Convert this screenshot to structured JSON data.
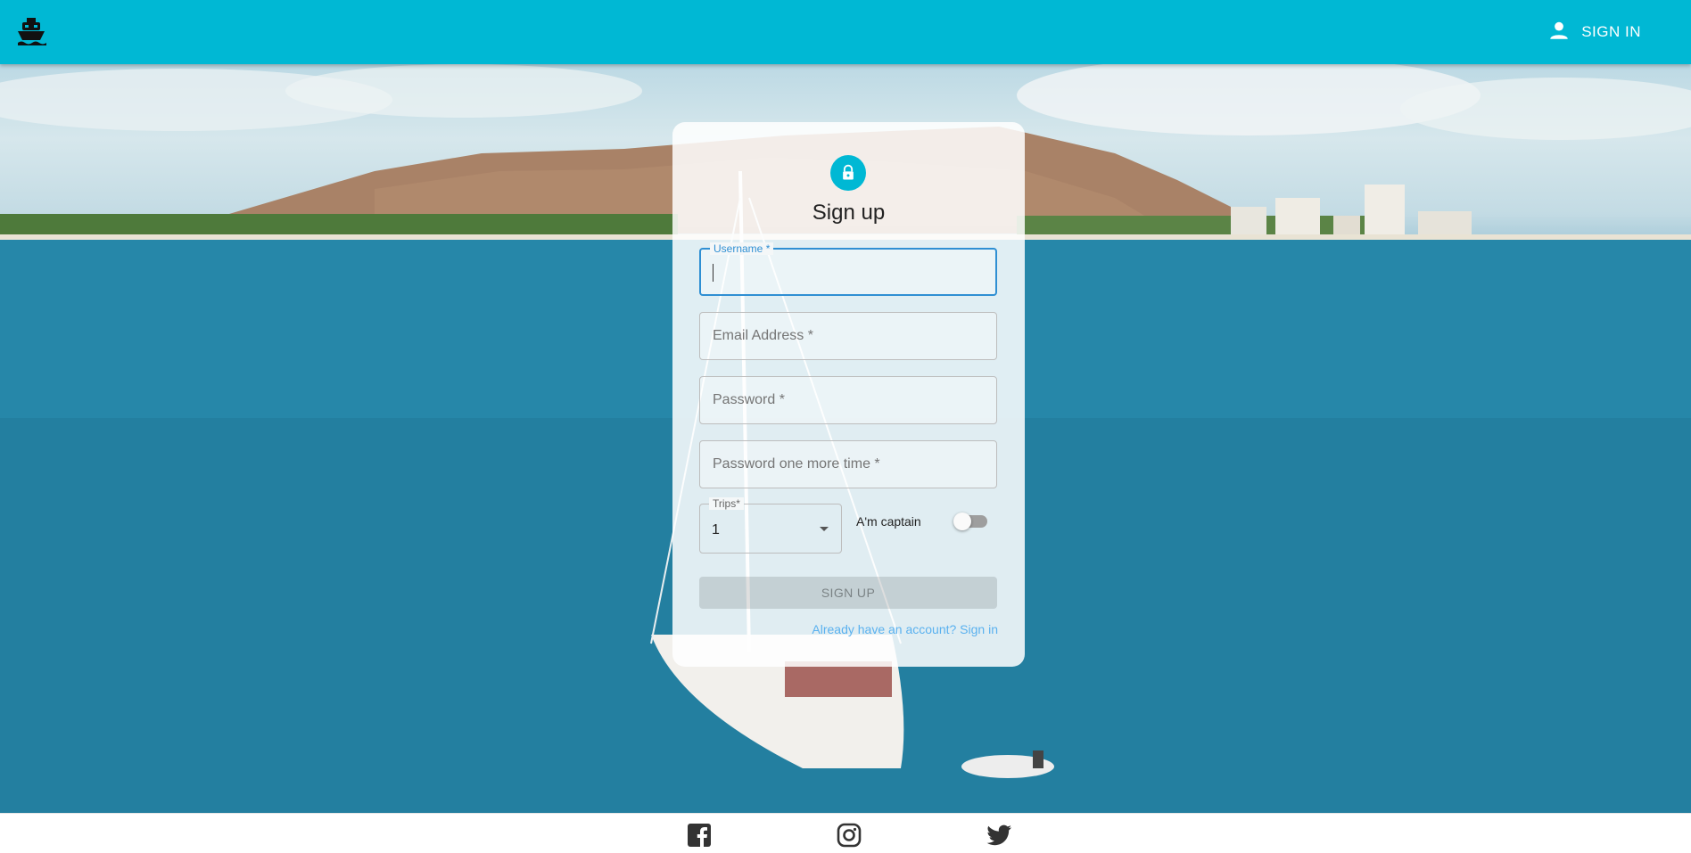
{
  "appbar": {
    "logo_icon": "ship-icon",
    "signin_icon": "person-icon",
    "signin_label": "SIGN IN",
    "color": "#00b8d4"
  },
  "form": {
    "lock_icon": "lock-icon",
    "title": "Sign up",
    "username_label": "Username *",
    "username_value": "",
    "email_placeholder": "Email Address *",
    "password_placeholder": "Password *",
    "password2_placeholder": "Password one more time *",
    "trips_label": "Trips*",
    "trips_value": "1",
    "captain_label": "A'm captain",
    "captain_checked": false,
    "submit_label": "SIGN UP",
    "signin_link": "Already have an account? Sign in"
  },
  "footer": {
    "icons": [
      "facebook-icon",
      "instagram-icon",
      "twitter-icon"
    ]
  }
}
